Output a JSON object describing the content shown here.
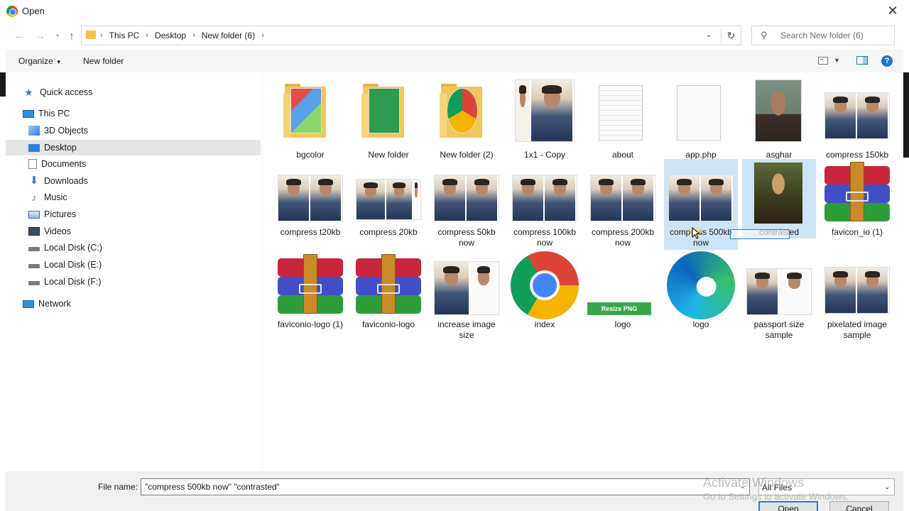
{
  "window": {
    "title": "Open"
  },
  "address": {
    "crumbs": [
      "This PC",
      "Desktop",
      "New folder (6)"
    ],
    "search_placeholder": "Search New folder (6)"
  },
  "toolbar": {
    "organize": "Organize",
    "new_folder": "New folder"
  },
  "sidebar": {
    "items": [
      {
        "label": "Quick access",
        "icon": "star-icon"
      },
      {
        "label": "This PC",
        "icon": "computer-icon"
      },
      {
        "label": "3D Objects",
        "icon": "cube-icon"
      },
      {
        "label": "Desktop",
        "icon": "desktop-icon",
        "selected": true
      },
      {
        "label": "Documents",
        "icon": "document-icon"
      },
      {
        "label": "Downloads",
        "icon": "download-icon"
      },
      {
        "label": "Music",
        "icon": "music-icon"
      },
      {
        "label": "Pictures",
        "icon": "pictures-icon"
      },
      {
        "label": "Videos",
        "icon": "video-icon"
      },
      {
        "label": "Local Disk (C:)",
        "icon": "disk-icon"
      },
      {
        "label": "Local Disk (E:)",
        "icon": "disk-icon"
      },
      {
        "label": "Local Disk (F:)",
        "icon": "disk-icon"
      },
      {
        "label": "Network",
        "icon": "network-icon"
      }
    ]
  },
  "files": [
    {
      "name": "bgcolor",
      "kind": "folder-notepad"
    },
    {
      "name": "New folder",
      "kind": "folder-green"
    },
    {
      "name": "New folder (2)",
      "kind": "folder-chrome"
    },
    {
      "name": "1x1 - Copy",
      "kind": "photo-single"
    },
    {
      "name": "about",
      "kind": "text-doc"
    },
    {
      "name": "app.php",
      "kind": "blank-doc"
    },
    {
      "name": "asghar",
      "kind": "portrait"
    },
    {
      "name": "compress  150kb",
      "kind": "photo-pair"
    },
    {
      "name": "compress  t20kb",
      "kind": "photo-pair"
    },
    {
      "name": "compress 20kb",
      "kind": "photo-pair"
    },
    {
      "name": "compress 50kb now",
      "kind": "photo-pair"
    },
    {
      "name": "compress 100kb now",
      "kind": "photo-pair"
    },
    {
      "name": "compress 200kb now",
      "kind": "photo-pair"
    },
    {
      "name": "compress 500kb now",
      "kind": "photo-pair",
      "selected": true
    },
    {
      "name": "contrasted",
      "kind": "mona",
      "selected": true
    },
    {
      "name": "favicon_io (1)",
      "kind": "winrar"
    },
    {
      "name": "faviconio-logo (1)",
      "kind": "winrar"
    },
    {
      "name": "faviconio-logo",
      "kind": "winrar"
    },
    {
      "name": "increase image size",
      "kind": "photo-pair"
    },
    {
      "name": "index",
      "kind": "chrome"
    },
    {
      "name": "logo",
      "kind": "resize-png",
      "badge": "Resize PNG"
    },
    {
      "name": "logo",
      "kind": "edge"
    },
    {
      "name": "passport size sample",
      "kind": "photo-pair"
    },
    {
      "name": "pixelated image sample",
      "kind": "photo-pair"
    }
  ],
  "bottom": {
    "file_name_label": "File name:",
    "file_name_value": "\"compress 500kb now\" \"contrasted\"",
    "file_type": "All Files",
    "open_label": "Open",
    "cancel_label": "Cancel"
  },
  "watermark": {
    "line1": "Activate Windows",
    "line2": "Go to Settings to activate Windows."
  },
  "colors": {
    "selection": "#cce4f7",
    "accent": "#2a7bd6",
    "sidebar_selected": "#e5e5e5"
  }
}
